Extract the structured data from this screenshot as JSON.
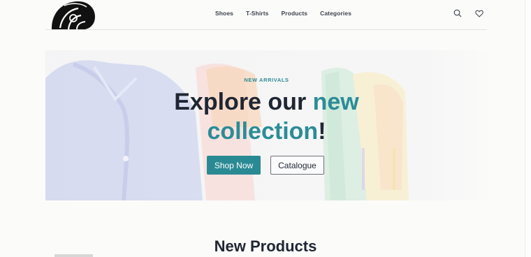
{
  "nav": {
    "items": [
      "Shoes",
      "T-Shirts",
      "Products",
      "Categories"
    ]
  },
  "header": {
    "logo_icon": "shell-logo-icon",
    "search_icon": "search-icon",
    "wishlist_icon": "heart-icon"
  },
  "hero": {
    "eyebrow": "NEW ARRIVALS",
    "headline_part1": "Explore our ",
    "headline_accent1": "new",
    "headline_accent2": "collection",
    "headline_end": "!",
    "primary_button": "Shop Now",
    "secondary_button": "Catalogue"
  },
  "section": {
    "title": "New Products"
  },
  "colors": {
    "accent": "#2a8a94",
    "text_dark": "#1f2633"
  }
}
